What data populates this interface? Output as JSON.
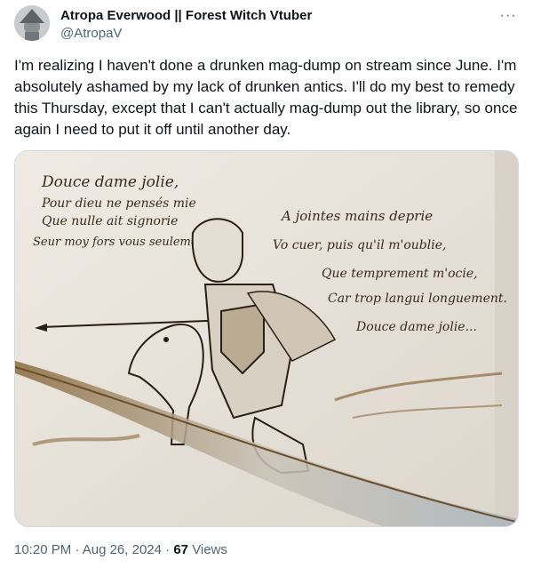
{
  "author": {
    "display_name": "Atropa Everwood || Forest Witch Vtuber",
    "handle": "@AtropaV"
  },
  "more_label": "···",
  "tweet": {
    "text": "I'm realizing I haven't done a drunken mag-dump on stream since June. I'm absolutely ashamed by my lack of drunken antics.  I'll do my best to remedy this Thursday, except that I can't actually mag-dump out the library, so once again I need to put it off until another day."
  },
  "image": {
    "poem_left": [
      "Douce dame jolie,",
      "Pour dieu ne pensés mie",
      "Que nulle ait signorie",
      "Seur moy fors vous seulement."
    ],
    "poem_right": [
      "A jointes mains deprie",
      "Vo cuer, puis qu'il m'oublie,",
      "Que temprement m'ocie,",
      "Car trop langui longuement.",
      "Douce dame jolie..."
    ],
    "ink_color": "#3a2a1a",
    "paper_color": "#ece7df"
  },
  "meta": {
    "time": "10:20 PM",
    "separator": "·",
    "date": "Aug 26, 2024",
    "views_count": "67",
    "views_label": "Views"
  }
}
